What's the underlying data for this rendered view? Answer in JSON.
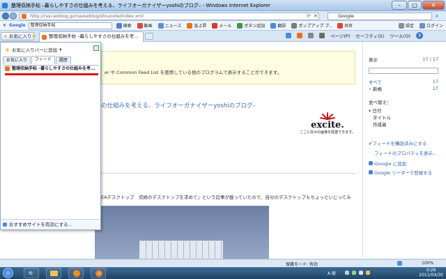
{
  "window": {
    "title": "整理収納手帖 –暮らしやすさの仕組みを考える、ライフオーガナイザーyoshiのブログ– - Windows Internet Explorer",
    "min": "–",
    "max": "□",
    "close": "✕"
  },
  "address": {
    "url": "http://rssi.exblog.jp/rss/exblog/shiunote/index.xml",
    "search_provider": "Google"
  },
  "google_toolbar": {
    "logo": "Google",
    "query": "整理収納手帖",
    "buttons": [
      "検索",
      "動画",
      "ニュース",
      "急上昇",
      "メール",
      "ボタン追加",
      "翻訳",
      "ポップアップ ブ..",
      "共有"
    ],
    "settings": "設定",
    "login": "ログイン"
  },
  "tabs": {
    "favorites_button": "お気に入り",
    "active_tab": "整理収納手帖 –暮らしやすさの仕組みを考える..."
  },
  "command_bar": {
    "page": "ページ(P)",
    "safety": "セーフティ(S)",
    "tools": "ツール(O)",
    "help": "?"
  },
  "page": {
    "notice": "er や Common Feed List を使用している他のプログラムで表示することができます。",
    "blog_title": "の仕組みを考える、ライフオーガナイザーyoshiのブログ–",
    "excite_logo": "excite.",
    "excite_sub": "ここに好みの画像を配置できます。",
    "body_text": "EAデスクトップ　究極のデスクトップを求めて』という記事が載っていたので、自分のデスクトップもちょっといじってみ"
  },
  "feed_pane": {
    "show_label": "表示",
    "show_count": "17 / 17",
    "all_label": "すべて",
    "all_count": "17",
    "new_label": "新規",
    "new_count": "17",
    "sort_label": "並べ替え：",
    "sort_options": [
      "日付",
      "タイトル",
      "作成者"
    ],
    "actions": [
      "フィードを購読済みにする",
      "フィードのプロパティを表示...",
      "iGoogle に追加",
      "Google リーダーで登録する"
    ]
  },
  "favorites_panel": {
    "add_to_bar": "お気に入りバーに追加",
    "tabs": [
      "お気に入り",
      "フィード",
      "履歴"
    ],
    "active_tab_index": 1,
    "feed_item": "整理収納手帖 –暮らしやすさの仕組みを考...",
    "suggested_sites": "おすすめサイトを有効にする..."
  },
  "status": {
    "protected_mode": "保護モード: 有効",
    "zoom": "100%"
  },
  "taskbar": {
    "time": "0:26",
    "date": "2011/04/30"
  },
  "colors": {
    "accent_blue": "#2a5fae",
    "feed_orange": "#e8731c",
    "selection_red": "#d51a12"
  }
}
